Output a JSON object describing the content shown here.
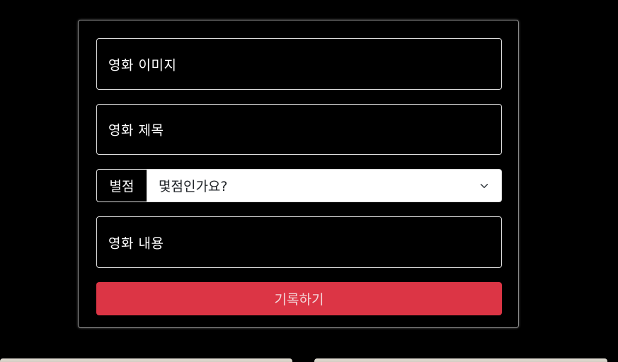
{
  "form": {
    "image_field_label": "영화 이미지",
    "title_field_label": "영화 제목",
    "rating": {
      "addon_label": "별점",
      "selected_option": "몇점인가요?"
    },
    "content_field_label": "영화 내용",
    "submit_label": "기록하기"
  },
  "icons": {
    "select_chevron": "chevron-down-icon"
  },
  "colors": {
    "background": "#000000",
    "submit_button": "#dc3545",
    "field_border": "#dcdcdc"
  }
}
